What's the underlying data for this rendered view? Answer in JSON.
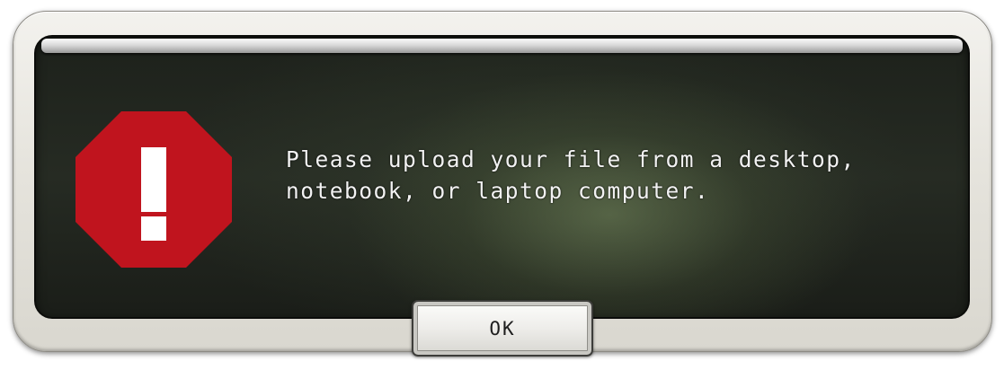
{
  "dialog": {
    "icon": "exclamation-stop-icon",
    "message_lines": [
      "Please upload your file from a desktop,",
      "notebook, or laptop computer."
    ],
    "ok_label": "OK"
  },
  "colors": {
    "stop_red": "#c0141e",
    "panel_dark": "#1f231c",
    "text": "#f2f2f2"
  }
}
